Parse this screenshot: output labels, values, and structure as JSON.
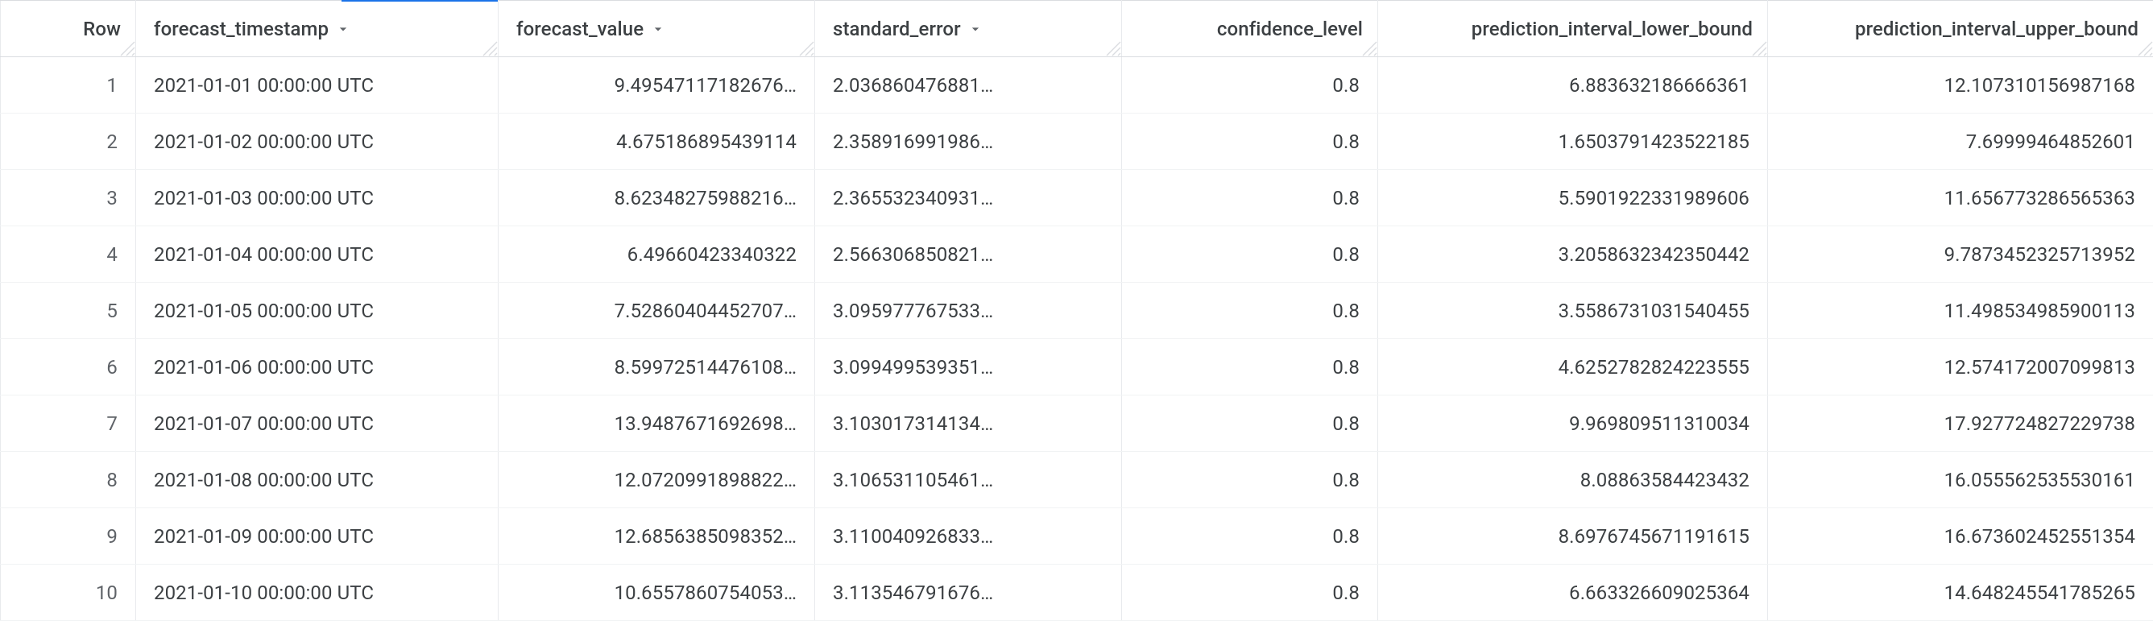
{
  "columns": {
    "row": "Row",
    "forecast_timestamp": "forecast_timestamp",
    "forecast_value": "forecast_value",
    "standard_error": "standard_error",
    "confidence_level": "confidence_level",
    "prediction_interval_lower_bound": "prediction_interval_lower_bound",
    "prediction_interval_upper_bound": "prediction_interval_upper_bound"
  },
  "rows": [
    {
      "n": "1",
      "ts": "2021-01-01 00:00:00 UTC",
      "fv": "9.49547117182676…",
      "se": "2.036860476881…",
      "cl": "0.8",
      "lb": "6.883632186666361",
      "ub": "12.107310156987168"
    },
    {
      "n": "2",
      "ts": "2021-01-02 00:00:00 UTC",
      "fv": "4.675186895439114",
      "se": "2.358916991986…",
      "cl": "0.8",
      "lb": "1.6503791423522185",
      "ub": "7.69999464852601"
    },
    {
      "n": "3",
      "ts": "2021-01-03 00:00:00 UTC",
      "fv": "8.62348275988216…",
      "se": "2.365532340931…",
      "cl": "0.8",
      "lb": "5.5901922331989606",
      "ub": "11.656773286565363"
    },
    {
      "n": "4",
      "ts": "2021-01-04 00:00:00 UTC",
      "fv": "6.49660423340322",
      "se": "2.566306850821…",
      "cl": "0.8",
      "lb": "3.2058632342350442",
      "ub": "9.7873452325713952"
    },
    {
      "n": "5",
      "ts": "2021-01-05 00:00:00 UTC",
      "fv": "7.52860404452707…",
      "se": "3.095977767533…",
      "cl": "0.8",
      "lb": "3.5586731031540455",
      "ub": "11.498534985900113"
    },
    {
      "n": "6",
      "ts": "2021-01-06 00:00:00 UTC",
      "fv": "8.59972514476108…",
      "se": "3.099499539351…",
      "cl": "0.8",
      "lb": "4.6252782824223555",
      "ub": "12.574172007099813"
    },
    {
      "n": "7",
      "ts": "2021-01-07 00:00:00 UTC",
      "fv": "13.9487671692698…",
      "se": "3.103017314134…",
      "cl": "0.8",
      "lb": "9.969809511310034",
      "ub": "17.927724827229738"
    },
    {
      "n": "8",
      "ts": "2021-01-08 00:00:00 UTC",
      "fv": "12.0720991898822…",
      "se": "3.106531105461…",
      "cl": "0.8",
      "lb": "8.08863584423432",
      "ub": "16.055562535530161"
    },
    {
      "n": "9",
      "ts": "2021-01-09 00:00:00 UTC",
      "fv": "12.6856385098352…",
      "se": "3.110040926833…",
      "cl": "0.8",
      "lb": "8.6976745671191615",
      "ub": "16.673602452551354"
    },
    {
      "n": "10",
      "ts": "2021-01-10 00:00:00 UTC",
      "fv": "10.6557860754053…",
      "se": "3.113546791676…",
      "cl": "0.8",
      "lb": "6.663326609025364",
      "ub": "14.648245541785265"
    }
  ]
}
